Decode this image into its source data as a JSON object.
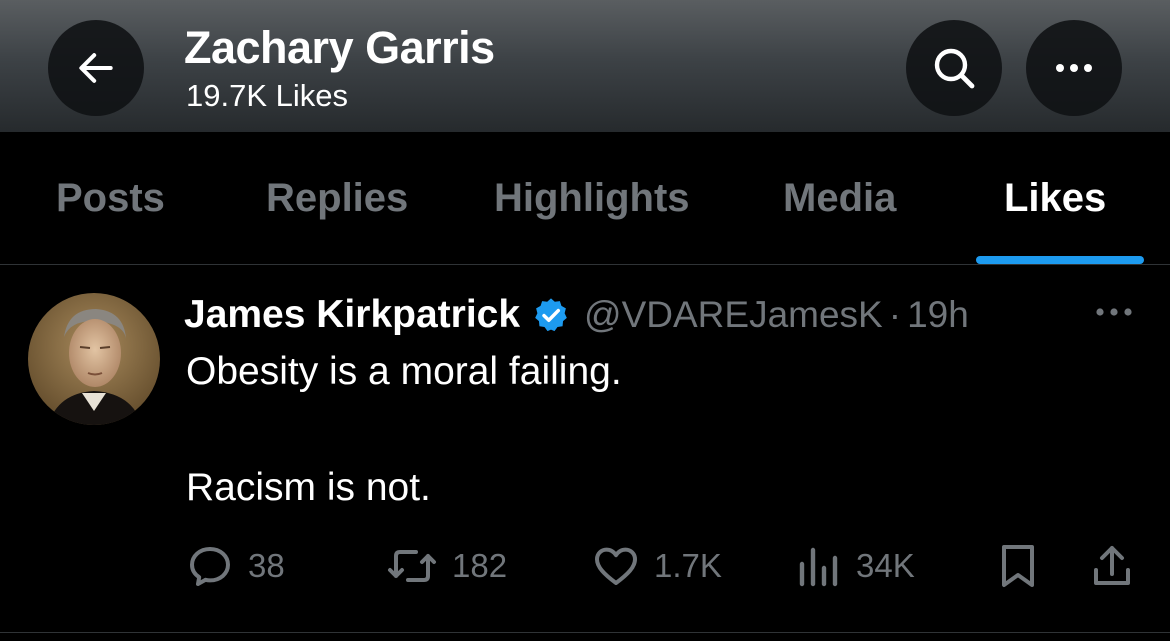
{
  "header": {
    "name": "Zachary Garris",
    "subtitle": "19.7K Likes",
    "back_icon": "arrow-left-icon",
    "search_icon": "search-icon",
    "more_icon": "more-horizontal-icon"
  },
  "tabs": [
    {
      "label": "Posts",
      "active": false
    },
    {
      "label": "Replies",
      "active": false
    },
    {
      "label": "Highlights",
      "active": false
    },
    {
      "label": "Media",
      "active": false
    },
    {
      "label": "Likes",
      "active": true
    }
  ],
  "tweet": {
    "author": "James Kirkpatrick",
    "verified": true,
    "handle": "@VDAREJamesK",
    "separator": "·",
    "time": "19h",
    "lines": [
      "Obesity is a moral failing.",
      "Racism is not."
    ],
    "actions": {
      "replies": "38",
      "reposts": "182",
      "likes": "1.7K",
      "views": "34K"
    }
  },
  "colors": {
    "accent": "#1d9bf0",
    "background": "#000000",
    "muted_text": "#71767b",
    "primary_text": "#ffffff"
  }
}
